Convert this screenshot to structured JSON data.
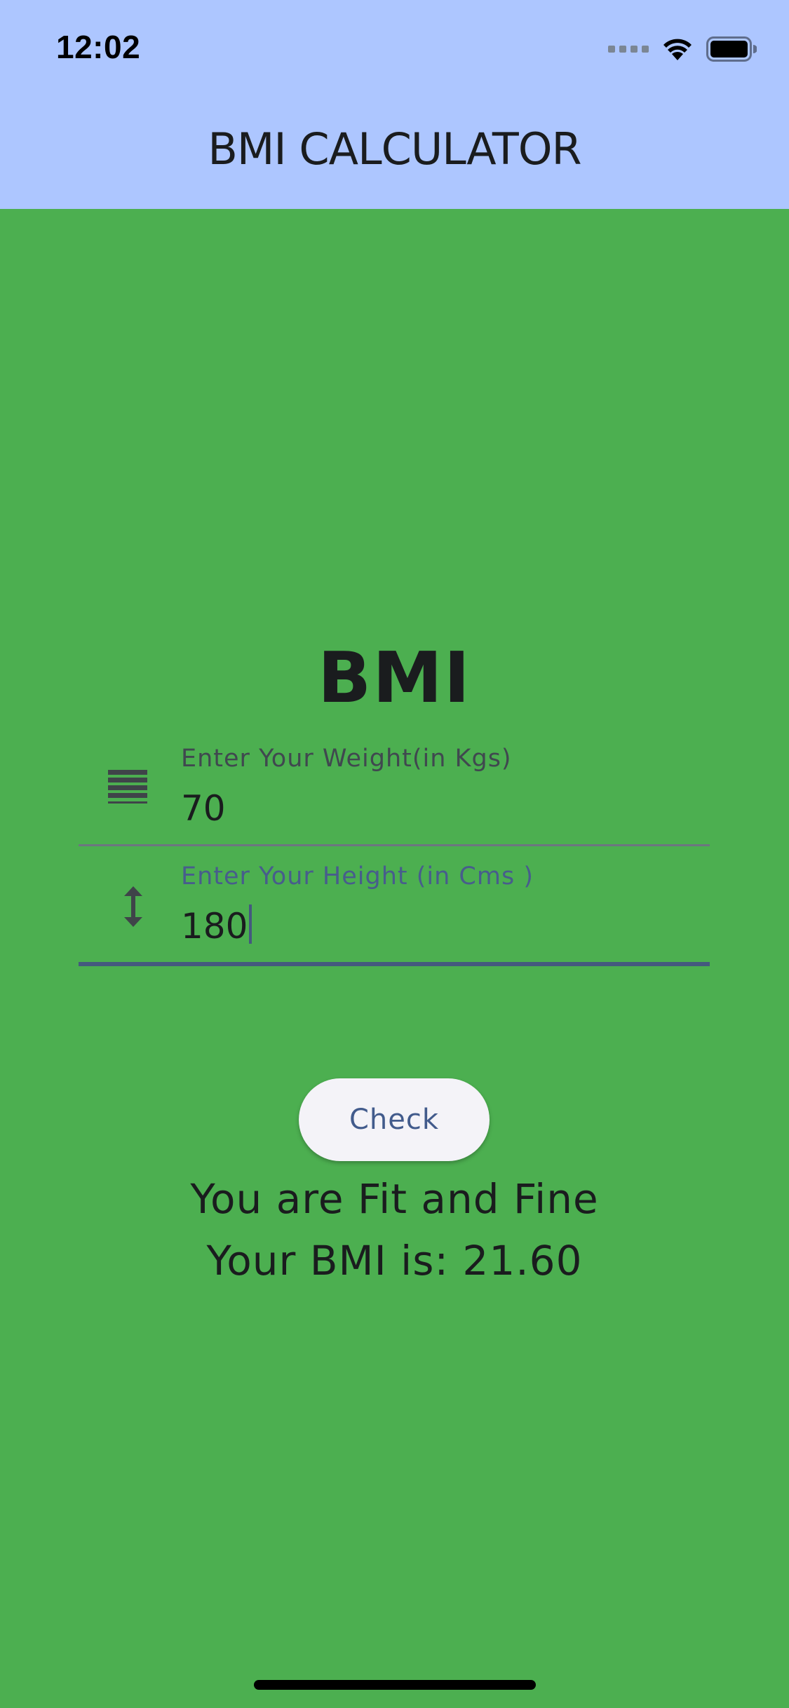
{
  "status_bar": {
    "time": "12:02"
  },
  "app_bar": {
    "title": "BMI CALCULATOR",
    "background_color": "#ADC6FF"
  },
  "main": {
    "background_color": "#4CAF50",
    "heading": "BMI",
    "weight_field": {
      "label": "Enter  Your Weight(in Kgs)",
      "value": "70",
      "icon": "lines-icon"
    },
    "height_field": {
      "label": "Enter Your Height (in Cms )",
      "value": "180",
      "icon": "vertical-arrows-icon",
      "focused": true
    },
    "check_button": {
      "label": "Check"
    },
    "result": {
      "status": "You are Fit and Fine",
      "bmi_text": "Your BMI is: 21.60"
    }
  }
}
